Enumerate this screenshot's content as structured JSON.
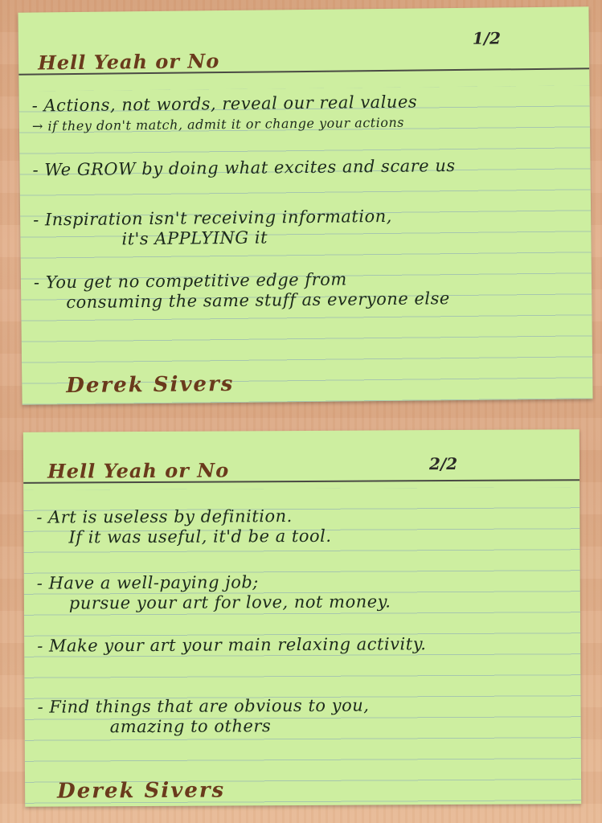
{
  "cards": [
    {
      "title": "Hell Yeah or No",
      "page": "1/2",
      "notes": [
        {
          "line1": "- Actions, not words, reveal our real values",
          "line2": "→ if they don't match, admit it or change your actions"
        },
        {
          "line1": "- We GROW by doing what excites and scare us"
        },
        {
          "line1": "- Inspiration isn't receiving information,",
          "line2": "it's APPLYING it"
        },
        {
          "line1": "- You get no competitive edge from",
          "line2": "consuming the same stuff as everyone else"
        }
      ],
      "signature": "Derek Sivers"
    },
    {
      "title": "Hell Yeah or No",
      "page": "2/2",
      "notes": [
        {
          "line1": "- Art is useless by definition.",
          "line2": "If it was useful, it'd be a tool."
        },
        {
          "line1": "- Have a well-paying job;",
          "line2": "pursue your art for love, not money."
        },
        {
          "line1": "- Make your art your main relaxing activity."
        },
        {
          "line1": "- Find things that are obvious to you,",
          "line2": "amazing to others"
        }
      ],
      "signature": "Derek Sivers"
    }
  ],
  "colors": {
    "card": "#cdeea0",
    "ink": "#1d2a1c",
    "signature": "#6a3a1c",
    "desk": "#dcaa84"
  }
}
